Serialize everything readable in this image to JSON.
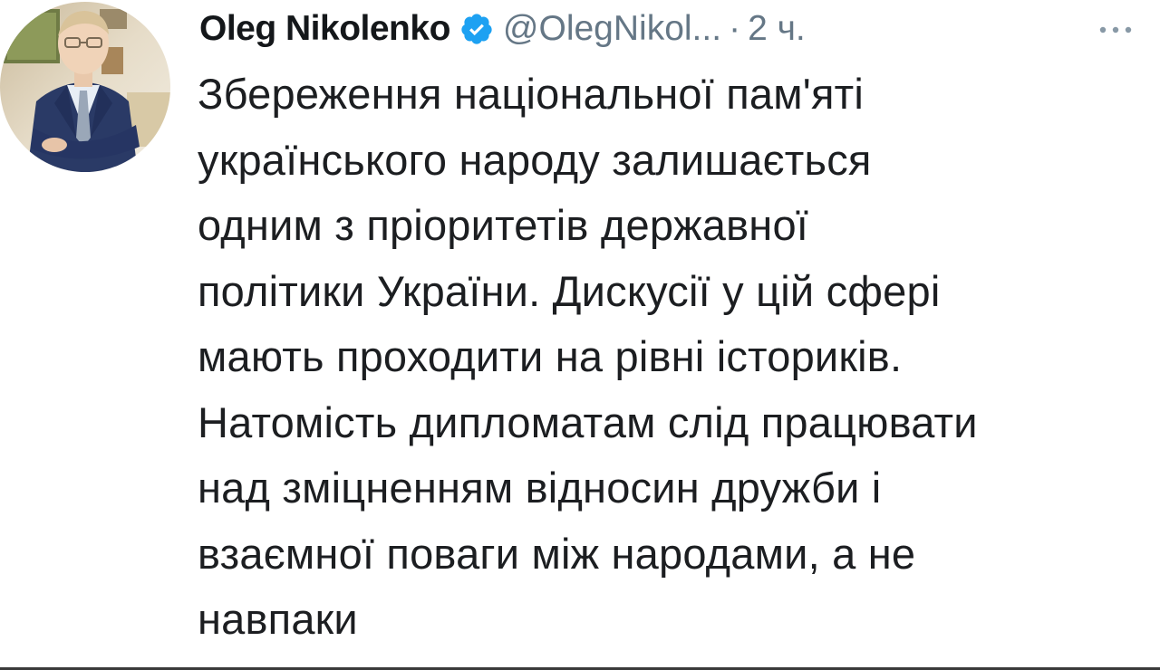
{
  "tweet": {
    "author": {
      "display_name": "Oleg Nikolenko",
      "handle": "@OlegNikol...",
      "verified": true,
      "avatar_icon": "profile-photo"
    },
    "separator": "·",
    "time": "2 ч.",
    "more_icon": "ellipsis-icon",
    "text_lines": [
      "Збереження національної пам'яті",
      "українського народу залишається",
      "одним з пріоритетів державної",
      "політики України. Дискусії у цій сфері",
      "мають проходити на рівні істориків.",
      "Натомість дипломатам слід працювати",
      "над зміцненням відносин дружби і",
      "взаємної поваги між народами, а не",
      "навпаки"
    ]
  },
  "colors": {
    "verified_blue": "#1da1f2",
    "secondary_text": "#657786",
    "primary_text": "#14171a"
  }
}
